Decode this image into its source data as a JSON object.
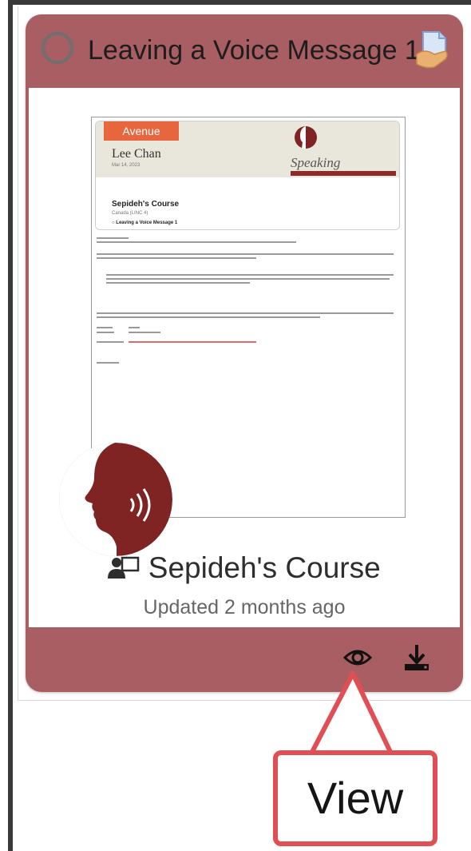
{
  "card": {
    "title": "Leaving a Voice Message 1",
    "course_name": "Sepideh's Course",
    "updated_text": "Updated 2 months ago"
  },
  "thumbnail": {
    "tab_label": "Avenue",
    "student_name": "Lee Chan",
    "date": "Mar 14, 2023",
    "skill": "Speaking",
    "course": "Sepideh's Course",
    "course_sub": "Canada (LINC 4)",
    "assignment": "Leaving a Voice Message 1"
  },
  "footer": {
    "view_icon": "eye-icon",
    "download_icon": "download-icon"
  },
  "callout": {
    "label": "View"
  },
  "colors": {
    "card_bg": "#a85e62",
    "callout_border": "#e14f55",
    "avatar_red": "#7f2323",
    "thumb_tab": "#e8663d"
  }
}
